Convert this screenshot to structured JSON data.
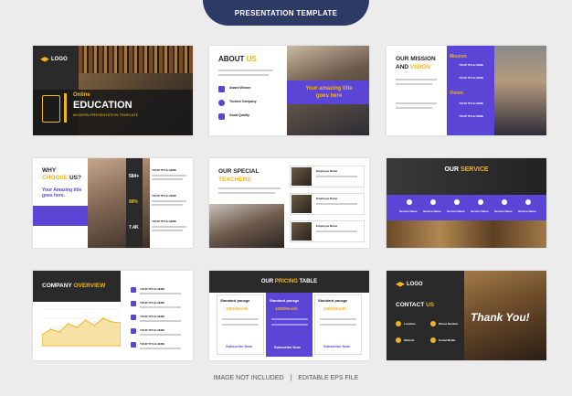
{
  "header": {
    "title": "PRESENTATION TEMPLATE"
  },
  "slides": {
    "education": {
      "logo": "LOGO",
      "online": "Online",
      "title": "EDUCATION",
      "subtitle": "MODERN PRESENTATION TEMPLATE"
    },
    "about": {
      "title_a": "ABOUT",
      "title_b": "US",
      "tagline": "Your amazing title goes here",
      "items": [
        "Award Winner",
        "Trusted Company",
        "Good Quality"
      ]
    },
    "mission": {
      "title_a": "OUR MISSION",
      "title_b": "AND",
      "title_c": "VISION",
      "mission": "Mission",
      "vision": "Vision",
      "item": "YOUR TITLE HERE"
    },
    "choose": {
      "title_a": "WHY",
      "title_b": "CHOOSE",
      "title_c": "US?",
      "tagline": "Your Amazing title goes here.",
      "stats": [
        "584+",
        "98%",
        "7.4K"
      ],
      "item": "YOUR TITLE HERE"
    },
    "teachers": {
      "title_a": "OUR SPECIAL",
      "title_b": "TEACHERS",
      "name": "Employee Name"
    },
    "service": {
      "title_a": "OUR",
      "title_b": "SERVICE",
      "items": [
        "Service Name",
        "Service Name",
        "Service Name",
        "Service Name",
        "Service Name",
        "Service Name"
      ]
    },
    "overview": {
      "title_a": "COMPANY",
      "title_b": "OVERVIEW",
      "item": "YOUR TITLE HERE"
    },
    "pricing": {
      "title_a": "OUR",
      "title_b": "PRICING",
      "title_c": "TABLE",
      "plan": "Standard pacage",
      "price": "100$/Month",
      "cta": "Subscribe Now"
    },
    "contact": {
      "logo": "LOGO",
      "title_a": "CONTACT",
      "title_b": "US",
      "thanks": "Thank You!",
      "items": [
        "Location",
        "Phone Number",
        "Website",
        "Social Media"
      ]
    }
  },
  "chart_data": {
    "type": "area",
    "values": [
      12,
      18,
      15,
      24,
      20,
      28,
      22,
      30,
      26,
      25
    ],
    "ylim": [
      0,
      40
    ]
  },
  "footer": {
    "left": "IMAGE NOT INCLUDED",
    "right": "EDITABLE  EPS FILE",
    "sep": "|"
  },
  "colors": {
    "navy": "#2e3a66",
    "purple": "#5b45d6",
    "yellow": "#f3b51f",
    "dark": "#222222"
  }
}
